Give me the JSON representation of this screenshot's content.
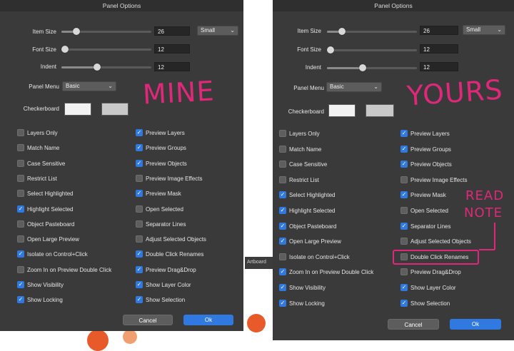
{
  "panels": [
    {
      "title": "Panel Options",
      "labels": {
        "item_size": "Item Size",
        "font_size": "Font Size",
        "indent": "Indent",
        "panel_menu": "Panel Menu",
        "checkerboard": "Checkerboard"
      },
      "item_size": {
        "value": "26",
        "level": 0.17
      },
      "font_size": {
        "value": "12",
        "level": 0.04
      },
      "indent": {
        "value": "12",
        "level": 0.4
      },
      "item_size_select": "Small",
      "panel_menu_select": "Basic",
      "checkerboard_colors": [
        "#f2f2f2",
        "#c9c9c9"
      ],
      "left_options": [
        {
          "label": "Layers Only",
          "checked": false
        },
        {
          "label": "Match Name",
          "checked": false
        },
        {
          "label": "Case Sensitive",
          "checked": false
        },
        {
          "label": "Restrict List",
          "checked": false
        },
        {
          "label": "Select Highlighted",
          "checked": false
        },
        {
          "label": "Highlight Selected",
          "checked": true
        },
        {
          "label": "Object Pasteboard",
          "checked": false
        },
        {
          "label": "Open Large Preview",
          "checked": false
        },
        {
          "label": "Isolate on Control+Click",
          "checked": true
        },
        {
          "label": "Zoom In on Preview Double Click",
          "checked": false
        },
        {
          "label": "Show Visibility",
          "checked": true
        },
        {
          "label": "Show Locking",
          "checked": true
        }
      ],
      "right_options": [
        {
          "label": "Preview Layers",
          "checked": true
        },
        {
          "label": "Preview Groups",
          "checked": true
        },
        {
          "label": "Preview Objects",
          "checked": true
        },
        {
          "label": "Preview Image Effects",
          "checked": false
        },
        {
          "label": "Preview Mask",
          "checked": true
        },
        {
          "label": "Open Selected",
          "checked": false
        },
        {
          "label": "Separator Lines",
          "checked": false
        },
        {
          "label": "Adjust Selected Objects",
          "checked": false
        },
        {
          "label": "Double Click Renames",
          "checked": true
        },
        {
          "label": "Preview Drag&Drop",
          "checked": true
        },
        {
          "label": "Show Layer Color",
          "checked": true
        },
        {
          "label": "Show Selection",
          "checked": true
        }
      ],
      "cancel_label": "Cancel",
      "ok_label": "Ok",
      "annotation": "MINE"
    },
    {
      "title": "Panel Options",
      "labels": {
        "item_size": "Item Size",
        "font_size": "Font Size",
        "indent": "Indent",
        "panel_menu": "Panel Menu",
        "checkerboard": "Checkerboard"
      },
      "item_size": {
        "value": "26",
        "level": 0.17
      },
      "font_size": {
        "value": "12",
        "level": 0.04
      },
      "indent": {
        "value": "12",
        "level": 0.4
      },
      "item_size_select": "Small",
      "panel_menu_select": "Basic",
      "checkerboard_colors": [
        "#f2f2f2",
        "#c9c9c9"
      ],
      "left_options": [
        {
          "label": "Layers Only",
          "checked": false
        },
        {
          "label": "Match Name",
          "checked": false
        },
        {
          "label": "Case Sensitive",
          "checked": false
        },
        {
          "label": "Restrict List",
          "checked": false
        },
        {
          "label": "Select Highlighted",
          "checked": true
        },
        {
          "label": "Highlight Selected",
          "checked": true
        },
        {
          "label": "Object Pasteboard",
          "checked": true
        },
        {
          "label": "Open Large Preview",
          "checked": true
        },
        {
          "label": "Isolate on Control+Click",
          "checked": false
        },
        {
          "label": "Zoom In on Preview Double Click",
          "checked": true
        },
        {
          "label": "Show Visibility",
          "checked": true
        },
        {
          "label": "Show Locking",
          "checked": true
        }
      ],
      "right_options": [
        {
          "label": "Preview Layers",
          "checked": true
        },
        {
          "label": "Preview Groups",
          "checked": true
        },
        {
          "label": "Preview Objects",
          "checked": true
        },
        {
          "label": "Preview Image Effects",
          "checked": false
        },
        {
          "label": "Preview Mask",
          "checked": true
        },
        {
          "label": "Open Selected",
          "checked": false
        },
        {
          "label": "Separator Lines",
          "checked": true
        },
        {
          "label": "Adjust Selected Objects",
          "checked": false
        },
        {
          "label": "Double Click Renames",
          "checked": false
        },
        {
          "label": "Preview Drag&Drop",
          "checked": false
        },
        {
          "label": "Show Layer Color",
          "checked": true
        },
        {
          "label": "Show Selection",
          "checked": true
        }
      ],
      "cancel_label": "Cancel",
      "ok_label": "Ok",
      "annotation": "YOURS",
      "note_line1": "READ",
      "note_line2": "NOTE"
    }
  ],
  "background_label": "Artboard",
  "colors": {
    "accent": "#2f79e0",
    "panel": "#3a3a3a",
    "annotation": "#e0287a"
  }
}
